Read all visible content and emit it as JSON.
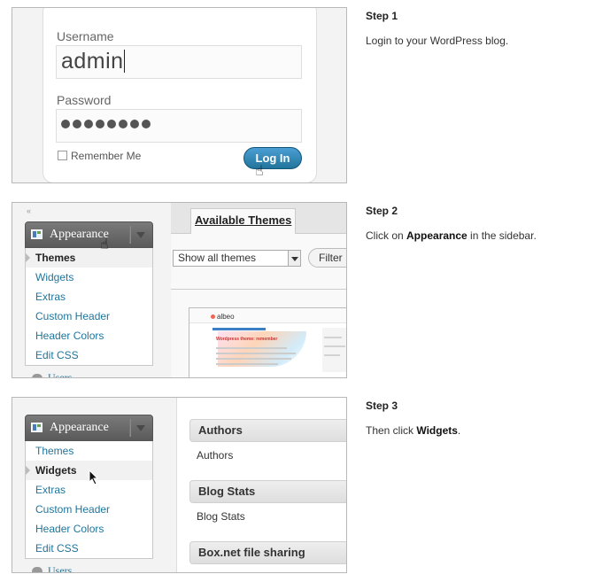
{
  "steps": [
    {
      "heading": "Step 1",
      "desc": "Login to your WordPress blog."
    },
    {
      "heading": "Step 2",
      "desc_pre": "Click on ",
      "desc_bold": "Appearance",
      "desc_post": " in the sidebar."
    },
    {
      "heading": "Step 3",
      "desc_pre": "Then click ",
      "desc_bold": "Widgets",
      "desc_post": "."
    }
  ],
  "login": {
    "username_label": "Username",
    "username_value": "admin",
    "password_label": "Password",
    "password_mask_count": 8,
    "remember_label": "Remember Me",
    "login_button": "Log In"
  },
  "sidebar": {
    "section_title": "Appearance",
    "items": [
      "Themes",
      "Widgets",
      "Extras",
      "Custom Header",
      "Header Colors",
      "Edit CSS"
    ],
    "next_section": "Users"
  },
  "themes_page": {
    "tab_label": "Available Themes",
    "filter_select": "Show all themes",
    "filter_button": "Filter",
    "thumbnail_logo": "albeo",
    "thumbnail_title": "Wordpress theme: remember"
  },
  "widgets_page": {
    "widgets": [
      {
        "title": "Authors",
        "desc": "Authors"
      },
      {
        "title": "Blog Stats",
        "desc": "Blog Stats"
      },
      {
        "title": "Box.net file sharing",
        "desc": ""
      }
    ]
  },
  "colors": {
    "link_blue": "#21759b",
    "button_blue": "#21759b",
    "sidebar_header": "#5a5a5a"
  }
}
